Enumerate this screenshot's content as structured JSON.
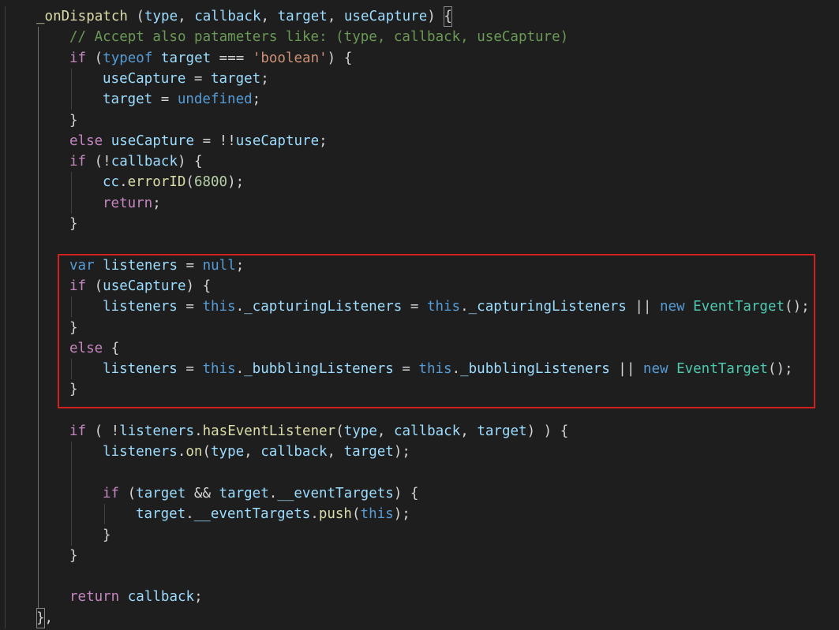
{
  "editor": {
    "theme_colors": {
      "background": "#1e1e1e",
      "highlight_box": "#d21f1f",
      "function": "#dcdcaa",
      "variable": "#9cdcfe",
      "keyword": "#569cd6",
      "control": "#c586c0",
      "string": "#ce9178",
      "number": "#b5cea8",
      "comment": "#6a9955",
      "class": "#4ec9b0"
    },
    "lines": [
      {
        "indent": 1,
        "tokens": [
          {
            "t": "_onDispatch",
            "c": "fn"
          },
          {
            "t": " (",
            "c": "pl"
          },
          {
            "t": "type",
            "c": "var"
          },
          {
            "t": ", ",
            "c": "pl"
          },
          {
            "t": "callback",
            "c": "var"
          },
          {
            "t": ", ",
            "c": "pl"
          },
          {
            "t": "target",
            "c": "var"
          },
          {
            "t": ", ",
            "c": "pl"
          },
          {
            "t": "useCapture",
            "c": "var"
          },
          {
            "t": ") ",
            "c": "pl"
          },
          {
            "t": "{",
            "c": "pl",
            "bracket": true
          }
        ]
      },
      {
        "indent": 2,
        "tokens": [
          {
            "t": "// Accept also patameters like: (type, callback, useCapture)",
            "c": "cm"
          }
        ]
      },
      {
        "indent": 2,
        "tokens": [
          {
            "t": "if",
            "c": "ctrl"
          },
          {
            "t": " (",
            "c": "pl"
          },
          {
            "t": "typeof",
            "c": "kw"
          },
          {
            "t": " ",
            "c": "pl"
          },
          {
            "t": "target",
            "c": "var"
          },
          {
            "t": " === ",
            "c": "pl"
          },
          {
            "t": "'boolean'",
            "c": "str"
          },
          {
            "t": ") {",
            "c": "pl"
          }
        ]
      },
      {
        "indent": 3,
        "tokens": [
          {
            "t": "useCapture",
            "c": "var"
          },
          {
            "t": " = ",
            "c": "pl"
          },
          {
            "t": "target",
            "c": "var"
          },
          {
            "t": ";",
            "c": "pl"
          }
        ]
      },
      {
        "indent": 3,
        "tokens": [
          {
            "t": "target",
            "c": "var"
          },
          {
            "t": " = ",
            "c": "pl"
          },
          {
            "t": "undefined",
            "c": "kw"
          },
          {
            "t": ";",
            "c": "pl"
          }
        ]
      },
      {
        "indent": 2,
        "tokens": [
          {
            "t": "}",
            "c": "pl"
          }
        ]
      },
      {
        "indent": 2,
        "tokens": [
          {
            "t": "else",
            "c": "ctrl"
          },
          {
            "t": " ",
            "c": "pl"
          },
          {
            "t": "useCapture",
            "c": "var"
          },
          {
            "t": " = !!",
            "c": "pl"
          },
          {
            "t": "useCapture",
            "c": "var"
          },
          {
            "t": ";",
            "c": "pl"
          }
        ]
      },
      {
        "indent": 2,
        "tokens": [
          {
            "t": "if",
            "c": "ctrl"
          },
          {
            "t": " (!",
            "c": "pl"
          },
          {
            "t": "callback",
            "c": "var"
          },
          {
            "t": ") {",
            "c": "pl"
          }
        ]
      },
      {
        "indent": 3,
        "tokens": [
          {
            "t": "cc",
            "c": "var"
          },
          {
            "t": ".",
            "c": "pl"
          },
          {
            "t": "errorID",
            "c": "fn"
          },
          {
            "t": "(",
            "c": "pl"
          },
          {
            "t": "6800",
            "c": "num"
          },
          {
            "t": ");",
            "c": "pl"
          }
        ]
      },
      {
        "indent": 3,
        "tokens": [
          {
            "t": "return",
            "c": "ctrl"
          },
          {
            "t": ";",
            "c": "pl"
          }
        ]
      },
      {
        "indent": 2,
        "tokens": [
          {
            "t": "}",
            "c": "pl"
          }
        ]
      },
      {
        "indent": 0,
        "tokens": []
      },
      {
        "indent": 2,
        "tokens": [
          {
            "t": "var",
            "c": "kw"
          },
          {
            "t": " ",
            "c": "pl"
          },
          {
            "t": "listeners",
            "c": "var"
          },
          {
            "t": " = ",
            "c": "pl"
          },
          {
            "t": "null",
            "c": "kw"
          },
          {
            "t": ";",
            "c": "pl"
          }
        ]
      },
      {
        "indent": 2,
        "tokens": [
          {
            "t": "if",
            "c": "ctrl"
          },
          {
            "t": " (",
            "c": "pl"
          },
          {
            "t": "useCapture",
            "c": "var"
          },
          {
            "t": ") {",
            "c": "pl"
          }
        ]
      },
      {
        "indent": 3,
        "tokens": [
          {
            "t": "listeners",
            "c": "var"
          },
          {
            "t": " = ",
            "c": "pl"
          },
          {
            "t": "this",
            "c": "kw"
          },
          {
            "t": ".",
            "c": "pl"
          },
          {
            "t": "_capturingListeners",
            "c": "var"
          },
          {
            "t": " = ",
            "c": "pl"
          },
          {
            "t": "this",
            "c": "kw"
          },
          {
            "t": ".",
            "c": "pl"
          },
          {
            "t": "_capturingListeners",
            "c": "var"
          },
          {
            "t": " || ",
            "c": "pl"
          },
          {
            "t": "new",
            "c": "kw"
          },
          {
            "t": " ",
            "c": "pl"
          },
          {
            "t": "EventTarget",
            "c": "cls"
          },
          {
            "t": "();",
            "c": "pl"
          }
        ]
      },
      {
        "indent": 2,
        "tokens": [
          {
            "t": "}",
            "c": "pl"
          }
        ]
      },
      {
        "indent": 2,
        "tokens": [
          {
            "t": "else",
            "c": "ctrl"
          },
          {
            "t": " {",
            "c": "pl"
          }
        ]
      },
      {
        "indent": 3,
        "tokens": [
          {
            "t": "listeners",
            "c": "var"
          },
          {
            "t": " = ",
            "c": "pl"
          },
          {
            "t": "this",
            "c": "kw"
          },
          {
            "t": ".",
            "c": "pl"
          },
          {
            "t": "_bubblingListeners",
            "c": "var"
          },
          {
            "t": " = ",
            "c": "pl"
          },
          {
            "t": "this",
            "c": "kw"
          },
          {
            "t": ".",
            "c": "pl"
          },
          {
            "t": "_bubblingListeners",
            "c": "var"
          },
          {
            "t": " || ",
            "c": "pl"
          },
          {
            "t": "new",
            "c": "kw"
          },
          {
            "t": " ",
            "c": "pl"
          },
          {
            "t": "EventTarget",
            "c": "cls"
          },
          {
            "t": "();",
            "c": "pl"
          }
        ]
      },
      {
        "indent": 2,
        "tokens": [
          {
            "t": "}",
            "c": "pl"
          }
        ]
      },
      {
        "indent": 0,
        "tokens": []
      },
      {
        "indent": 2,
        "tokens": [
          {
            "t": "if",
            "c": "ctrl"
          },
          {
            "t": " ( !",
            "c": "pl"
          },
          {
            "t": "listeners",
            "c": "var"
          },
          {
            "t": ".",
            "c": "pl"
          },
          {
            "t": "hasEventListener",
            "c": "fn"
          },
          {
            "t": "(",
            "c": "pl"
          },
          {
            "t": "type",
            "c": "var"
          },
          {
            "t": ", ",
            "c": "pl"
          },
          {
            "t": "callback",
            "c": "var"
          },
          {
            "t": ", ",
            "c": "pl"
          },
          {
            "t": "target",
            "c": "var"
          },
          {
            "t": ") ) {",
            "c": "pl"
          }
        ]
      },
      {
        "indent": 3,
        "tokens": [
          {
            "t": "listeners",
            "c": "var"
          },
          {
            "t": ".",
            "c": "pl"
          },
          {
            "t": "on",
            "c": "fn"
          },
          {
            "t": "(",
            "c": "pl"
          },
          {
            "t": "type",
            "c": "var"
          },
          {
            "t": ", ",
            "c": "pl"
          },
          {
            "t": "callback",
            "c": "var"
          },
          {
            "t": ", ",
            "c": "pl"
          },
          {
            "t": "target",
            "c": "var"
          },
          {
            "t": ");",
            "c": "pl"
          }
        ]
      },
      {
        "indent": 0,
        "tokens": []
      },
      {
        "indent": 3,
        "tokens": [
          {
            "t": "if",
            "c": "ctrl"
          },
          {
            "t": " (",
            "c": "pl"
          },
          {
            "t": "target",
            "c": "var"
          },
          {
            "t": " && ",
            "c": "pl"
          },
          {
            "t": "target",
            "c": "var"
          },
          {
            "t": ".",
            "c": "pl"
          },
          {
            "t": "__eventTargets",
            "c": "var"
          },
          {
            "t": ") {",
            "c": "pl"
          }
        ]
      },
      {
        "indent": 4,
        "tokens": [
          {
            "t": "target",
            "c": "var"
          },
          {
            "t": ".",
            "c": "pl"
          },
          {
            "t": "__eventTargets",
            "c": "var"
          },
          {
            "t": ".",
            "c": "pl"
          },
          {
            "t": "push",
            "c": "fn"
          },
          {
            "t": "(",
            "c": "pl"
          },
          {
            "t": "this",
            "c": "kw"
          },
          {
            "t": ");",
            "c": "pl"
          }
        ]
      },
      {
        "indent": 3,
        "tokens": [
          {
            "t": "}",
            "c": "pl"
          }
        ]
      },
      {
        "indent": 2,
        "tokens": [
          {
            "t": "}",
            "c": "pl"
          }
        ]
      },
      {
        "indent": 0,
        "tokens": []
      },
      {
        "indent": 2,
        "tokens": [
          {
            "t": "return",
            "c": "ctrl"
          },
          {
            "t": " ",
            "c": "pl"
          },
          {
            "t": "callback",
            "c": "var"
          },
          {
            "t": ";",
            "c": "pl"
          }
        ]
      },
      {
        "indent": 1,
        "tokens": [
          {
            "t": "}",
            "c": "pl",
            "bracket": true
          },
          {
            "t": ",",
            "c": "pl"
          }
        ]
      }
    ]
  }
}
